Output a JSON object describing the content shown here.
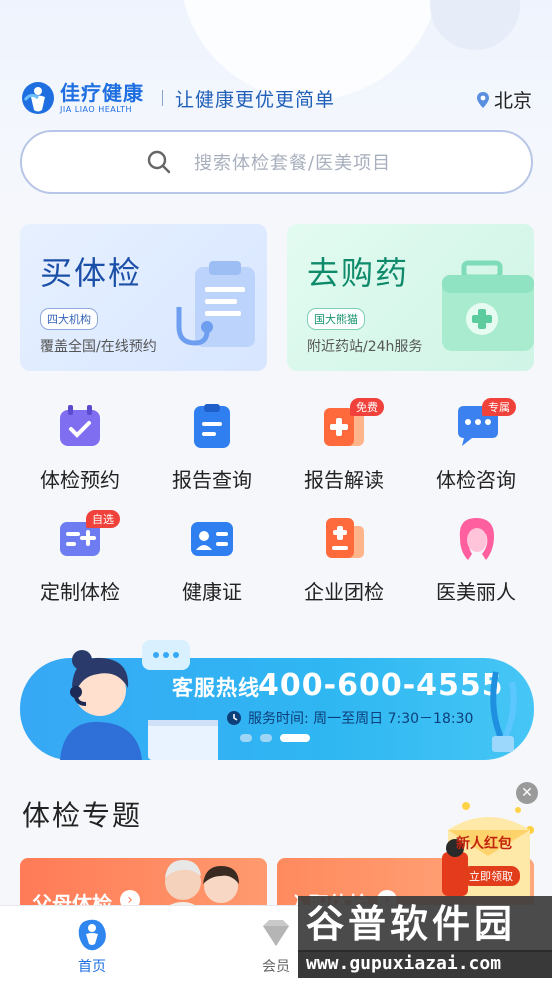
{
  "header": {
    "logo_cn": "佳疗健康",
    "logo_en": "JIA LIAO HEALTH",
    "slogan": "让健康更优更简单",
    "city": "北京",
    "brand_color": "#1f6fe0"
  },
  "search": {
    "placeholder": "搜索体检套餐/医美项目"
  },
  "cards": [
    {
      "title": "买体检",
      "tag": "四大机构",
      "desc": "覆盖全国/在线预约",
      "icon": "clipboard-stethoscope-icon"
    },
    {
      "title": "去购药",
      "tag": "国大熊猫",
      "desc": "附近药站/24h服务",
      "icon": "medkit-icon"
    }
  ],
  "grid": [
    {
      "label": "体检预约",
      "icon": "calendar-check-icon",
      "badge": ""
    },
    {
      "label": "报告查询",
      "icon": "report-icon",
      "badge": ""
    },
    {
      "label": "报告解读",
      "icon": "report-plus-icon",
      "badge": "免费"
    },
    {
      "label": "体检咨询",
      "icon": "chat-icon",
      "badge": "专属"
    },
    {
      "label": "定制体检",
      "icon": "custom-card-icon",
      "badge": "自选"
    },
    {
      "label": "健康证",
      "icon": "id-card-icon",
      "badge": ""
    },
    {
      "label": "企业团检",
      "icon": "enterprise-doc-icon",
      "badge": ""
    },
    {
      "label": "医美丽人",
      "icon": "beauty-icon",
      "badge": ""
    }
  ],
  "banner": {
    "hotline_label": "客服热线",
    "hotline_number": "400-600-4555",
    "hours": "服务时间:  周一至周日 7:30－18:30",
    "pages": 3,
    "active_page": 3
  },
  "section": {
    "title": "体检专题"
  },
  "promos": [
    {
      "title": "父母体检"
    },
    {
      "title": "入职体检"
    }
  ],
  "float": {
    "redpack_title": "新人红包",
    "redpack_button": "立即领取"
  },
  "tabbar": {
    "home": "首页",
    "member": "会员",
    "active": "home"
  },
  "watermark": {
    "cn": "谷普软件园",
    "url": "www.gupuxiazai.com"
  }
}
